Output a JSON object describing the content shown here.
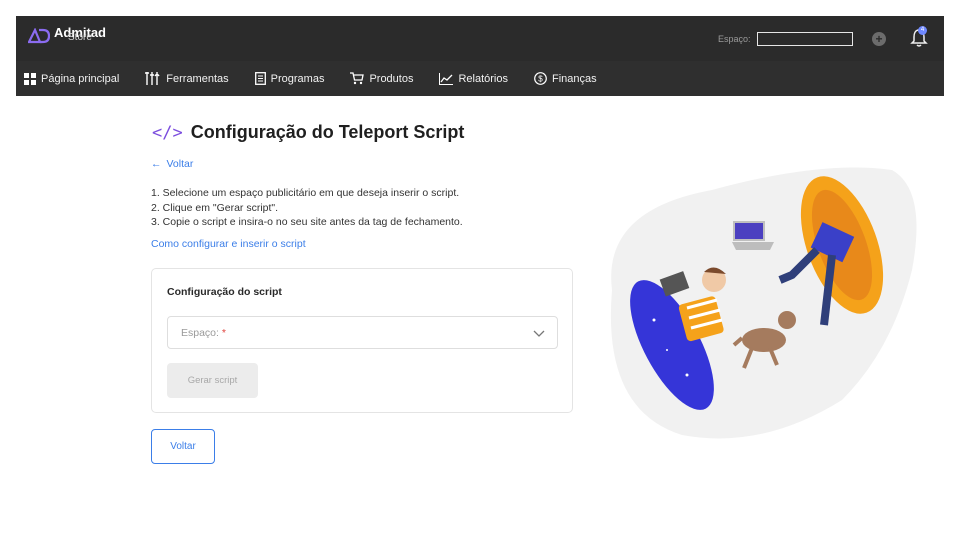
{
  "header": {
    "logo_text": "Admitad",
    "logo_sub": "Store",
    "space_label": "Espaço:",
    "space_value": "",
    "notification_count": "4",
    "colors": {
      "bar": "#2b2b2b",
      "accent": "#7b4dde"
    }
  },
  "nav": {
    "items": [
      {
        "label": "Página principal",
        "icon": "grid-icon"
      },
      {
        "label": "Ferramentas",
        "icon": "tools-icon"
      },
      {
        "label": "Programas",
        "icon": "document-icon"
      },
      {
        "label": "Produtos",
        "icon": "cart-icon"
      },
      {
        "label": "Relatórios",
        "icon": "chart-icon"
      },
      {
        "label": "Finanças",
        "icon": "dollar-circle-icon"
      }
    ]
  },
  "main": {
    "title_icon": "</>",
    "title": "Configuração do Teleport Script",
    "back_link": "Voltar",
    "steps": [
      "1. Selecione um espaço publicitário em que deseja inserir o script.",
      "2. Clique em \"Gerar script\".",
      "3. Copie o script e insira-o no seu site antes da tag de fechamento."
    ],
    "help_link": "Como configurar e inserir o script",
    "card": {
      "title": "Configuração do script",
      "select_label": "Espaço:",
      "required_mark": "*",
      "generate_button": "Gerar script"
    },
    "back_button": "Voltar"
  }
}
